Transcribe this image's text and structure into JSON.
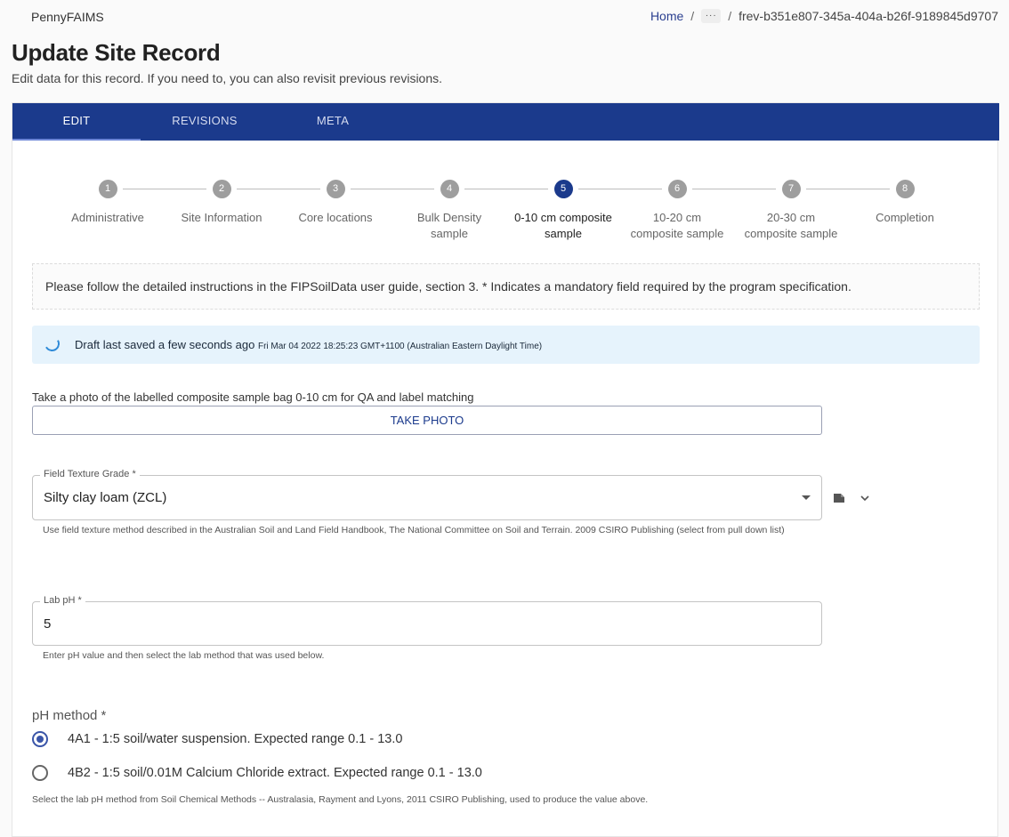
{
  "app": {
    "name": "PennyFAIMS"
  },
  "breadcrumb": {
    "home": "Home",
    "ellipsis": "···",
    "current": "frev-b351e807-345a-404a-b26f-9189845d9707"
  },
  "header": {
    "title": "Update Site Record",
    "subtitle": "Edit data for this record. If you need to, you can also revisit previous revisions."
  },
  "tabs": [
    {
      "label": "EDIT",
      "active": true
    },
    {
      "label": "REVISIONS",
      "active": false
    },
    {
      "label": "META",
      "active": false
    }
  ],
  "steps": [
    {
      "number": "1",
      "label": "Administrative"
    },
    {
      "number": "2",
      "label": "Site Information"
    },
    {
      "number": "3",
      "label": "Core locations"
    },
    {
      "number": "4",
      "label": "Bulk Density sample"
    },
    {
      "number": "5",
      "label": "0-10 cm composite sample",
      "active": true
    },
    {
      "number": "6",
      "label": "10-20 cm composite sample"
    },
    {
      "number": "7",
      "label": "20-30 cm composite sample"
    },
    {
      "number": "8",
      "label": "Completion"
    }
  ],
  "info": {
    "text": "Please follow the detailed instructions in the FIPSoilData user guide, section 3. * Indicates a mandatory field required by the program specification."
  },
  "draft": {
    "text": "Draft last saved a few seconds ago",
    "time": "Fri Mar 04 2022 18:25:23 GMT+1100 (Australian Eastern Daylight Time)"
  },
  "photo": {
    "label": "Take a photo of the labelled composite sample bag 0-10 cm for QA and label matching",
    "button": "TAKE PHOTO"
  },
  "texture": {
    "legend": "Field Texture Grade *",
    "value": "Silty clay loam (ZCL)",
    "helper": "Use field texture method described in the Australian Soil and Land Field Handbook, The National Committee on Soil and Terrain. 2009 CSIRO Publishing (select from pull down list)"
  },
  "ph": {
    "legend": "Lab pH *",
    "value": "5",
    "helper": "Enter pH value and then select the lab method that was used below."
  },
  "ph_method": {
    "label": "pH method *",
    "options": [
      {
        "label": "4A1 - 1:5 soil/water suspension. Expected range 0.1 - 13.0",
        "checked": true
      },
      {
        "label": "4B2 - 1:5 soil/0.01M Calcium Chloride extract. Expected range 0.1 - 13.0",
        "checked": false
      }
    ],
    "helper": "Select the lab pH method from Soil Chemical Methods -- Australasia, Rayment and Lyons, 2011 CSIRO Publishing, used to produce the value above."
  },
  "icons": {
    "annotation": "comment-icon",
    "expand": "chevron-down-icon"
  },
  "colors": {
    "primary": "#1b3a8c",
    "alert_bg": "#e6f3fc",
    "step_inactive": "#9e9e9e"
  }
}
